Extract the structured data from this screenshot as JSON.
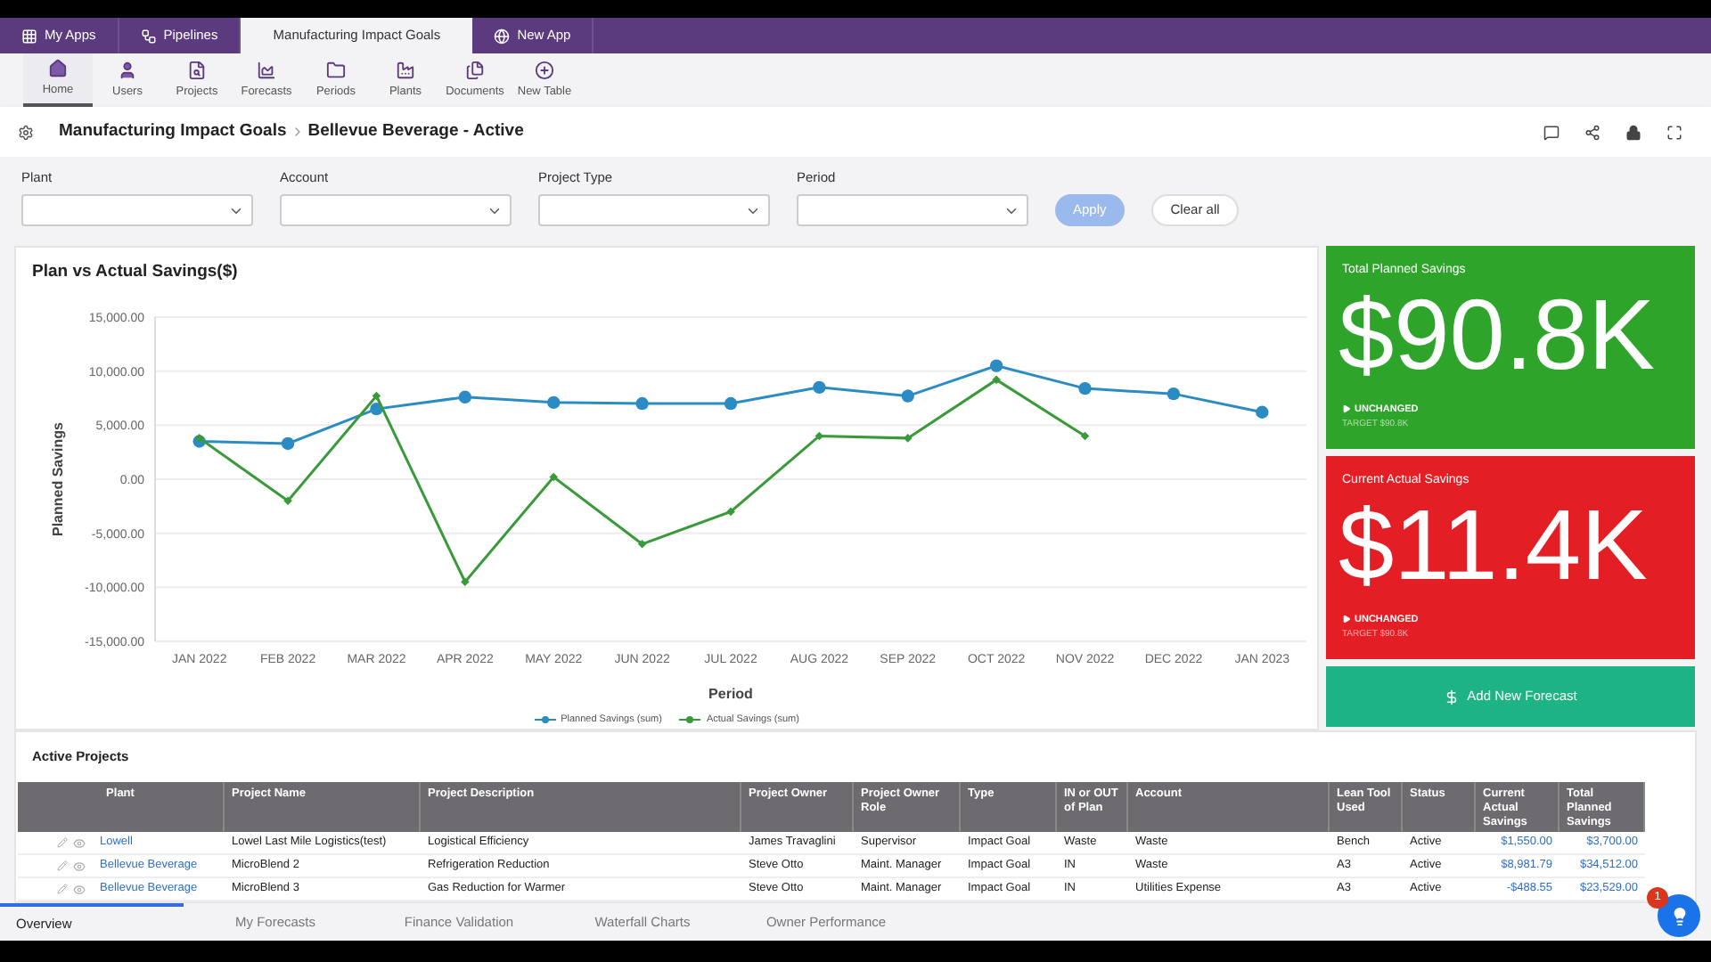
{
  "app_tabs": [
    {
      "label": "My Apps",
      "kind": "apps",
      "selected": false
    },
    {
      "label": "Pipelines",
      "kind": "pipelines",
      "selected": false
    },
    {
      "label": "Manufacturing Impact Goals",
      "kind": "plain",
      "selected": true
    },
    {
      "label": "New App",
      "kind": "new",
      "selected": false
    }
  ],
  "toolbar": [
    {
      "label": "Home",
      "kind": "home",
      "selected": true
    },
    {
      "label": "Users",
      "kind": "users",
      "selected": false
    },
    {
      "label": "Projects",
      "kind": "projects",
      "selected": false
    },
    {
      "label": "Forecasts",
      "kind": "forecasts",
      "selected": false
    },
    {
      "label": "Periods",
      "kind": "periods",
      "selected": false
    },
    {
      "label": "Plants",
      "kind": "plants",
      "selected": false
    },
    {
      "label": "Documents",
      "kind": "documents",
      "selected": false
    },
    {
      "label": "New Table",
      "kind": "new",
      "selected": false
    }
  ],
  "breadcrumb": [
    "Manufacturing Impact Goals",
    "Bellevue Beverage - Active"
  ],
  "filters": [
    {
      "label": "Plant"
    },
    {
      "label": "Account"
    },
    {
      "label": "Project Type"
    },
    {
      "label": "Period"
    }
  ],
  "apply_button": {
    "label": "Apply",
    "disabled": true
  },
  "clear_button": {
    "label": "Clear all"
  },
  "chart": {
    "title": "Plan vs Actual Savings($)",
    "chart_data": {
      "type": "line",
      "xlabel": "Period",
      "ylabel": "Planned Savings",
      "categories": [
        "JAN 2022",
        "FEB 2022",
        "MAR 2022",
        "APR 2022",
        "MAY 2022",
        "JUN 2022",
        "JUL 2022",
        "AUG 2022",
        "SEP 2022",
        "OCT 2022",
        "NOV 2022",
        "DEC 2022",
        "JAN 2023"
      ],
      "grid": true,
      "series": [
        {
          "name": "Planned Savings (sum)",
          "color": "#2b8cc4",
          "marker": "circle",
          "values": [
            3500,
            3300,
            6500,
            7600,
            7100,
            7000,
            7000,
            8500,
            7700,
            10500,
            8400,
            7900,
            6200
          ]
        },
        {
          "name": "Actual Savings (sum)",
          "color": "#3a9a3a",
          "marker": "diamond",
          "values": [
            3800,
            -2000,
            7700,
            -9500,
            200,
            -6000,
            -3000,
            4000,
            3800,
            9200,
            4000,
            null,
            null
          ]
        }
      ],
      "ylim": [
        -15000,
        15000
      ],
      "yticks": [
        {
          "value": 15000,
          "label": "15,000.00"
        },
        {
          "value": 10000,
          "label": "10,000.00"
        },
        {
          "value": 5000,
          "label": "5,000.00"
        },
        {
          "value": 0,
          "label": "0.00"
        },
        {
          "value": -5000,
          "label": "-5,000.00"
        },
        {
          "value": -10000,
          "label": "-10,000.00"
        },
        {
          "value": -15000,
          "label": "-15,000.00"
        }
      ]
    }
  },
  "kpis": [
    {
      "title": "Total Planned Savings",
      "value": "$90.8K",
      "change": "UNCHANGED",
      "target": "TARGET $90.8K",
      "color": "#2ea52a"
    },
    {
      "title": "Current Actual Savings",
      "value": "$11.4K",
      "change": "UNCHANGED",
      "target": "TARGET $90.8K",
      "color": "#e31e25"
    }
  ],
  "add_forecast_button": {
    "label": "Add New Forecast"
  },
  "table": {
    "title": "Active Projects",
    "columns": [
      "Plant",
      "Project Name",
      "Project Description",
      "Project Owner",
      "Project Owner Role",
      "Type",
      "IN or OUT of Plan",
      "Account",
      "Lean Tool Used",
      "Status",
      "Current Actual Savings",
      "Total Planned Savings"
    ],
    "rows": [
      [
        "Lowell",
        "Lowel Last Mile Logistics(test)",
        "Logistical Efficiency",
        "James Travaglini",
        "Supervisor",
        "Impact Goal",
        "Waste",
        "Waste",
        "Bench",
        "Active",
        "$1,550.00",
        "$3,700.00"
      ],
      [
        "Bellevue Beverage",
        "MicroBlend 2",
        "Refrigeration Reduction",
        "Steve Otto",
        "Maint. Manager",
        "Impact Goal",
        "IN",
        "Waste",
        "A3",
        "Active",
        "$8,981.79",
        "$34,512.00"
      ],
      [
        "Bellevue Beverage",
        "MicroBlend 3",
        "Gas Reduction for Warmer",
        "Steve Otto",
        "Maint. Manager",
        "Impact Goal",
        "IN",
        "Utilities Expense",
        "A3",
        "Active",
        "-$488.55",
        "$23,529.00"
      ]
    ]
  },
  "bottom_tabs": [
    {
      "label": "Overview",
      "selected": true
    },
    {
      "label": "My Forecasts",
      "selected": false
    },
    {
      "label": "Finance Validation",
      "selected": false
    },
    {
      "label": "Waterfall Charts",
      "selected": false
    },
    {
      "label": "Owner Performance",
      "selected": false
    }
  ],
  "help_badge": "1"
}
